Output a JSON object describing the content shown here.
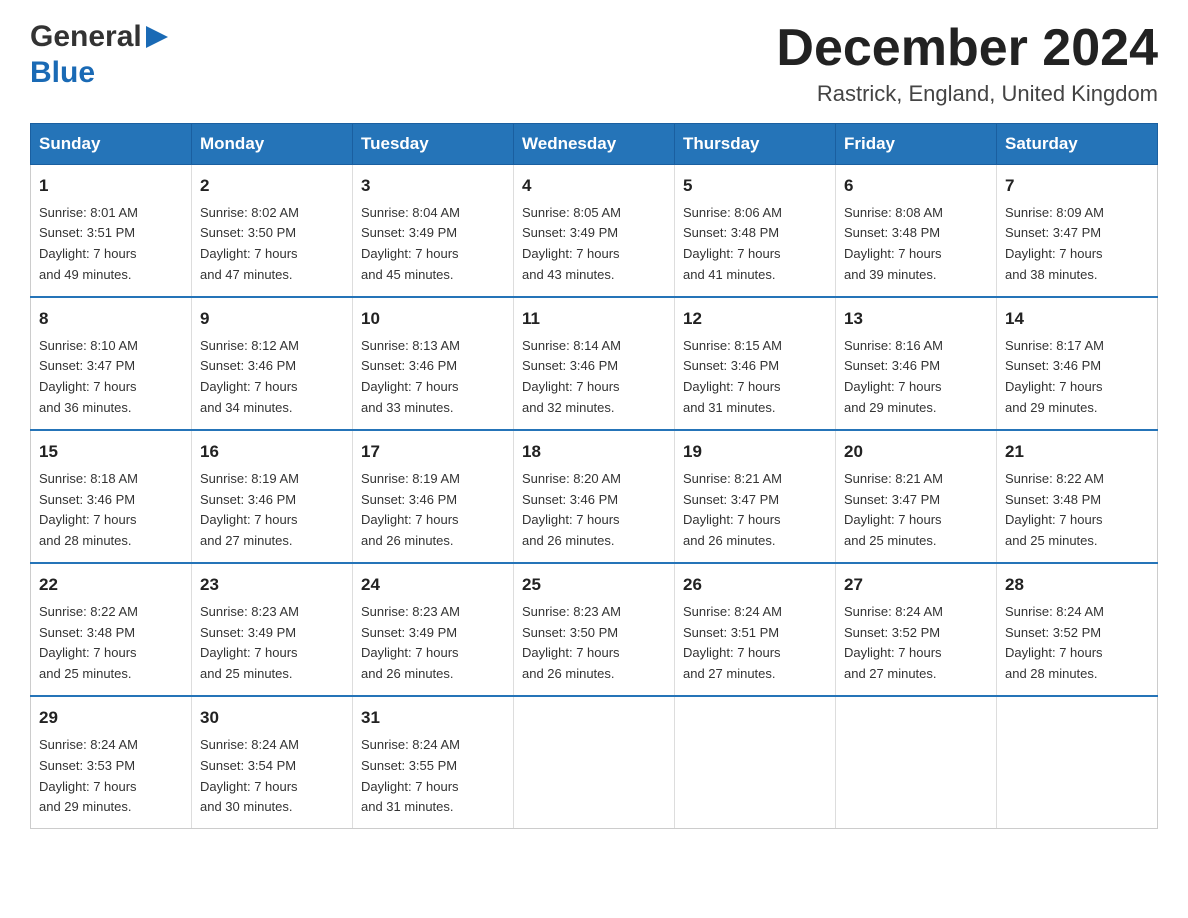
{
  "logo": {
    "general": "General",
    "blue": "Blue",
    "triangle": "▶"
  },
  "header": {
    "title": "December 2024",
    "location": "Rastrick, England, United Kingdom"
  },
  "columns": [
    "Sunday",
    "Monday",
    "Tuesday",
    "Wednesday",
    "Thursday",
    "Friday",
    "Saturday"
  ],
  "weeks": [
    [
      {
        "day": "1",
        "sunrise": "Sunrise: 8:01 AM",
        "sunset": "Sunset: 3:51 PM",
        "daylight": "Daylight: 7 hours",
        "daylight2": "and 49 minutes."
      },
      {
        "day": "2",
        "sunrise": "Sunrise: 8:02 AM",
        "sunset": "Sunset: 3:50 PM",
        "daylight": "Daylight: 7 hours",
        "daylight2": "and 47 minutes."
      },
      {
        "day": "3",
        "sunrise": "Sunrise: 8:04 AM",
        "sunset": "Sunset: 3:49 PM",
        "daylight": "Daylight: 7 hours",
        "daylight2": "and 45 minutes."
      },
      {
        "day": "4",
        "sunrise": "Sunrise: 8:05 AM",
        "sunset": "Sunset: 3:49 PM",
        "daylight": "Daylight: 7 hours",
        "daylight2": "and 43 minutes."
      },
      {
        "day": "5",
        "sunrise": "Sunrise: 8:06 AM",
        "sunset": "Sunset: 3:48 PM",
        "daylight": "Daylight: 7 hours",
        "daylight2": "and 41 minutes."
      },
      {
        "day": "6",
        "sunrise": "Sunrise: 8:08 AM",
        "sunset": "Sunset: 3:48 PM",
        "daylight": "Daylight: 7 hours",
        "daylight2": "and 39 minutes."
      },
      {
        "day": "7",
        "sunrise": "Sunrise: 8:09 AM",
        "sunset": "Sunset: 3:47 PM",
        "daylight": "Daylight: 7 hours",
        "daylight2": "and 38 minutes."
      }
    ],
    [
      {
        "day": "8",
        "sunrise": "Sunrise: 8:10 AM",
        "sunset": "Sunset: 3:47 PM",
        "daylight": "Daylight: 7 hours",
        "daylight2": "and 36 minutes."
      },
      {
        "day": "9",
        "sunrise": "Sunrise: 8:12 AM",
        "sunset": "Sunset: 3:46 PM",
        "daylight": "Daylight: 7 hours",
        "daylight2": "and 34 minutes."
      },
      {
        "day": "10",
        "sunrise": "Sunrise: 8:13 AM",
        "sunset": "Sunset: 3:46 PM",
        "daylight": "Daylight: 7 hours",
        "daylight2": "and 33 minutes."
      },
      {
        "day": "11",
        "sunrise": "Sunrise: 8:14 AM",
        "sunset": "Sunset: 3:46 PM",
        "daylight": "Daylight: 7 hours",
        "daylight2": "and 32 minutes."
      },
      {
        "day": "12",
        "sunrise": "Sunrise: 8:15 AM",
        "sunset": "Sunset: 3:46 PM",
        "daylight": "Daylight: 7 hours",
        "daylight2": "and 31 minutes."
      },
      {
        "day": "13",
        "sunrise": "Sunrise: 8:16 AM",
        "sunset": "Sunset: 3:46 PM",
        "daylight": "Daylight: 7 hours",
        "daylight2": "and 29 minutes."
      },
      {
        "day": "14",
        "sunrise": "Sunrise: 8:17 AM",
        "sunset": "Sunset: 3:46 PM",
        "daylight": "Daylight: 7 hours",
        "daylight2": "and 29 minutes."
      }
    ],
    [
      {
        "day": "15",
        "sunrise": "Sunrise: 8:18 AM",
        "sunset": "Sunset: 3:46 PM",
        "daylight": "Daylight: 7 hours",
        "daylight2": "and 28 minutes."
      },
      {
        "day": "16",
        "sunrise": "Sunrise: 8:19 AM",
        "sunset": "Sunset: 3:46 PM",
        "daylight": "Daylight: 7 hours",
        "daylight2": "and 27 minutes."
      },
      {
        "day": "17",
        "sunrise": "Sunrise: 8:19 AM",
        "sunset": "Sunset: 3:46 PM",
        "daylight": "Daylight: 7 hours",
        "daylight2": "and 26 minutes."
      },
      {
        "day": "18",
        "sunrise": "Sunrise: 8:20 AM",
        "sunset": "Sunset: 3:46 PM",
        "daylight": "Daylight: 7 hours",
        "daylight2": "and 26 minutes."
      },
      {
        "day": "19",
        "sunrise": "Sunrise: 8:21 AM",
        "sunset": "Sunset: 3:47 PM",
        "daylight": "Daylight: 7 hours",
        "daylight2": "and 26 minutes."
      },
      {
        "day": "20",
        "sunrise": "Sunrise: 8:21 AM",
        "sunset": "Sunset: 3:47 PM",
        "daylight": "Daylight: 7 hours",
        "daylight2": "and 25 minutes."
      },
      {
        "day": "21",
        "sunrise": "Sunrise: 8:22 AM",
        "sunset": "Sunset: 3:48 PM",
        "daylight": "Daylight: 7 hours",
        "daylight2": "and 25 minutes."
      }
    ],
    [
      {
        "day": "22",
        "sunrise": "Sunrise: 8:22 AM",
        "sunset": "Sunset: 3:48 PM",
        "daylight": "Daylight: 7 hours",
        "daylight2": "and 25 minutes."
      },
      {
        "day": "23",
        "sunrise": "Sunrise: 8:23 AM",
        "sunset": "Sunset: 3:49 PM",
        "daylight": "Daylight: 7 hours",
        "daylight2": "and 25 minutes."
      },
      {
        "day": "24",
        "sunrise": "Sunrise: 8:23 AM",
        "sunset": "Sunset: 3:49 PM",
        "daylight": "Daylight: 7 hours",
        "daylight2": "and 26 minutes."
      },
      {
        "day": "25",
        "sunrise": "Sunrise: 8:23 AM",
        "sunset": "Sunset: 3:50 PM",
        "daylight": "Daylight: 7 hours",
        "daylight2": "and 26 minutes."
      },
      {
        "day": "26",
        "sunrise": "Sunrise: 8:24 AM",
        "sunset": "Sunset: 3:51 PM",
        "daylight": "Daylight: 7 hours",
        "daylight2": "and 27 minutes."
      },
      {
        "day": "27",
        "sunrise": "Sunrise: 8:24 AM",
        "sunset": "Sunset: 3:52 PM",
        "daylight": "Daylight: 7 hours",
        "daylight2": "and 27 minutes."
      },
      {
        "day": "28",
        "sunrise": "Sunrise: 8:24 AM",
        "sunset": "Sunset: 3:52 PM",
        "daylight": "Daylight: 7 hours",
        "daylight2": "and 28 minutes."
      }
    ],
    [
      {
        "day": "29",
        "sunrise": "Sunrise: 8:24 AM",
        "sunset": "Sunset: 3:53 PM",
        "daylight": "Daylight: 7 hours",
        "daylight2": "and 29 minutes."
      },
      {
        "day": "30",
        "sunrise": "Sunrise: 8:24 AM",
        "sunset": "Sunset: 3:54 PM",
        "daylight": "Daylight: 7 hours",
        "daylight2": "and 30 minutes."
      },
      {
        "day": "31",
        "sunrise": "Sunrise: 8:24 AM",
        "sunset": "Sunset: 3:55 PM",
        "daylight": "Daylight: 7 hours",
        "daylight2": "and 31 minutes."
      },
      {
        "day": "",
        "sunrise": "",
        "sunset": "",
        "daylight": "",
        "daylight2": ""
      },
      {
        "day": "",
        "sunrise": "",
        "sunset": "",
        "daylight": "",
        "daylight2": ""
      },
      {
        "day": "",
        "sunrise": "",
        "sunset": "",
        "daylight": "",
        "daylight2": ""
      },
      {
        "day": "",
        "sunrise": "",
        "sunset": "",
        "daylight": "",
        "daylight2": ""
      }
    ]
  ]
}
